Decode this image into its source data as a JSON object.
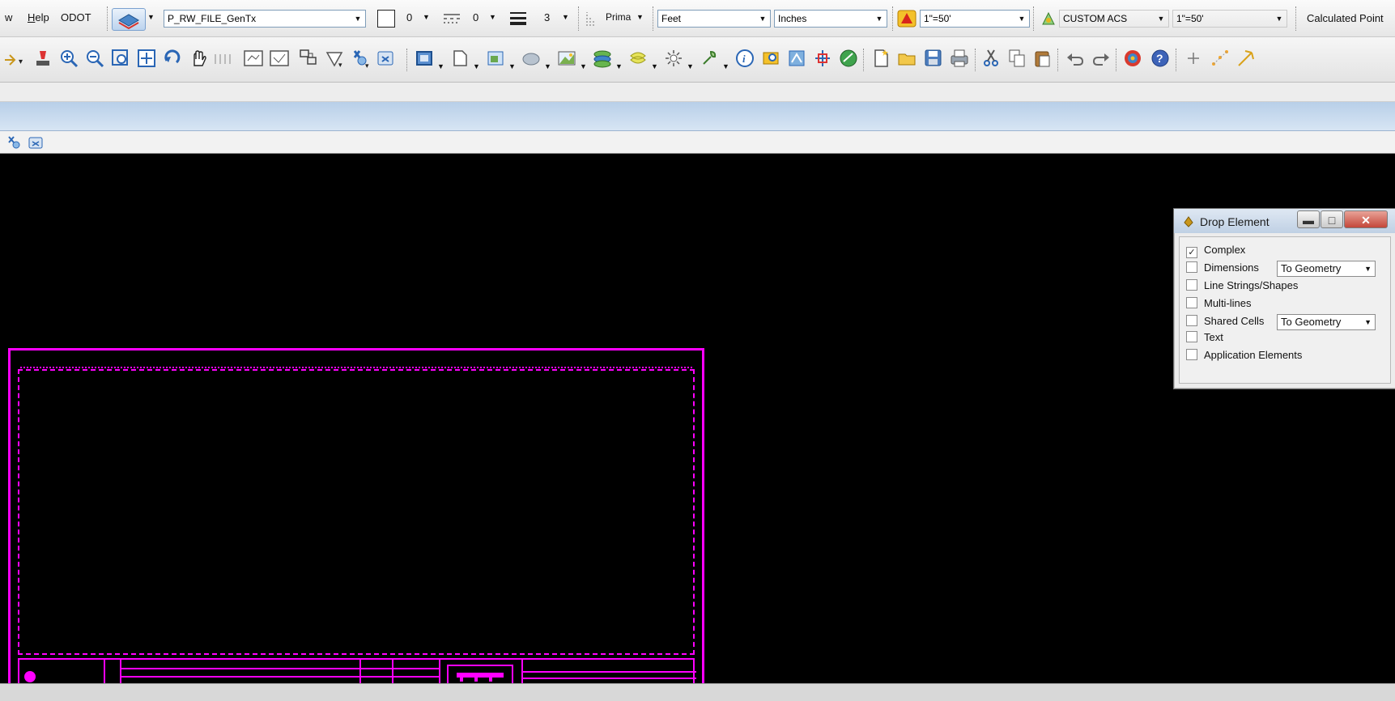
{
  "menu": {
    "items": [
      "w",
      "Help",
      "ODOT"
    ]
  },
  "toolbar1": {
    "level": "P_RW_FILE_GenTx",
    "color_value": "0",
    "style_value": "0",
    "weight_value": "3",
    "class_label": "Prima",
    "units_master": "Feet",
    "units_sub": "Inches",
    "annotation_scale": "1\"=50'",
    "acs": "CUSTOM ACS",
    "scale2": "1\"=50'",
    "snap_mode": "Calculated Point"
  },
  "dialog": {
    "title": "Drop Element",
    "options": [
      {
        "label": "Complex",
        "checked": true,
        "mark": "✓"
      },
      {
        "label": "Dimensions",
        "checked": false,
        "mark": "",
        "dropdown": "To Geometry"
      },
      {
        "label": "Line Strings/Shapes",
        "checked": false,
        "mark": ""
      },
      {
        "label": "Multi-lines",
        "checked": false,
        "mark": ""
      },
      {
        "label": "Shared Cells",
        "checked": false,
        "mark": "",
        "dropdown": "To Geometry"
      },
      {
        "label": "Text",
        "checked": false,
        "mark": ""
      },
      {
        "label": "Application Elements",
        "checked": false,
        "mark": ""
      }
    ]
  },
  "icons": {
    "toolbar2": [
      "place-icon",
      "zoom-in-icon",
      "zoom-out-icon",
      "window-area-icon",
      "fit-view-icon",
      "rotate-view-icon",
      "pan-icon",
      "view-previous-icon",
      "view-next-icon",
      "copy-view-icon",
      "clip-volume-icon",
      "fence-icon",
      "element-selection-icon",
      "delete-icon",
      "solids-icon",
      "drawing-icon",
      "tasks-icon",
      "mesh-icon",
      "terrain-icon",
      "layers-icon",
      "hatch-icon",
      "lighting-icon",
      "info-icon",
      "find-icon",
      "references-icon",
      "levels-icon",
      "new-file-icon",
      "open-folder-icon",
      "save-icon",
      "print-icon",
      "cut-icon",
      "copy-icon",
      "paste-icon",
      "undo-icon",
      "redo-icon",
      "render-icon",
      "help-icon",
      "accudraw-icon",
      "snap-icon"
    ]
  },
  "colors": {
    "drawing": "#ff00ff",
    "background": "#000000"
  }
}
